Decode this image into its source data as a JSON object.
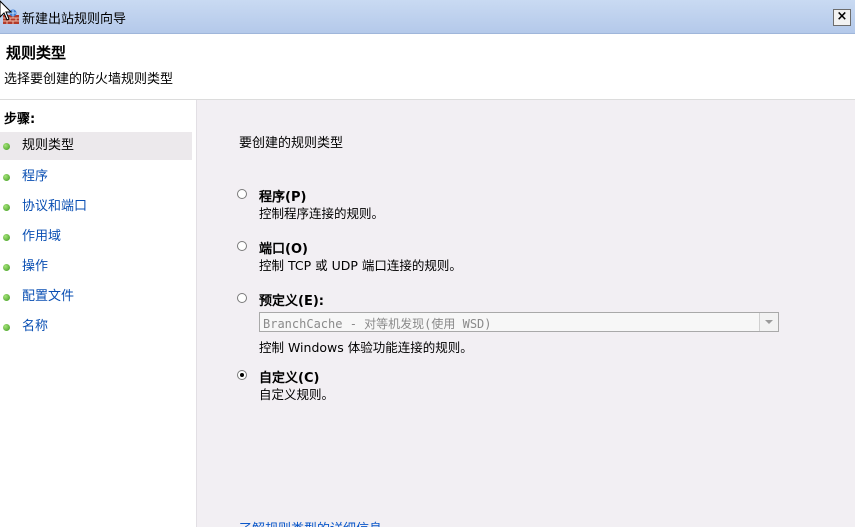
{
  "window": {
    "title": "新建出站规则向导",
    "close_glyph": "×"
  },
  "header": {
    "title": "规则类型",
    "subtitle": "选择要创建的防火墙规则类型"
  },
  "steps": {
    "label": "步骤:",
    "items": [
      {
        "label": "规则类型",
        "active": true
      },
      {
        "label": "程序"
      },
      {
        "label": "协议和端口"
      },
      {
        "label": "作用域"
      },
      {
        "label": "操作"
      },
      {
        "label": "配置文件"
      },
      {
        "label": "名称"
      }
    ]
  },
  "main": {
    "question": "要创建的规则类型",
    "options": [
      {
        "label": "程序(P)",
        "description": "控制程序连接的规则。",
        "selected": false
      },
      {
        "label": "端口(O)",
        "description": "控制 TCP 或 UDP 端口连接的规则。",
        "selected": false
      },
      {
        "label": "预定义(E):",
        "description": "控制 Windows 体验功能连接的规则。",
        "selected": false
      },
      {
        "label": "自定义(C)",
        "description": "自定义规则。",
        "selected": true
      }
    ],
    "predefined_select": {
      "value": "BranchCache - 对等机发现(使用 WSD)"
    },
    "learn_more": "了解规则类型的详细信息"
  },
  "colors": {
    "titlebar": "#b4c9ea",
    "content_bg": "#f2eff3",
    "link": "#0a57c9",
    "step_link": "#0a4fb3"
  }
}
